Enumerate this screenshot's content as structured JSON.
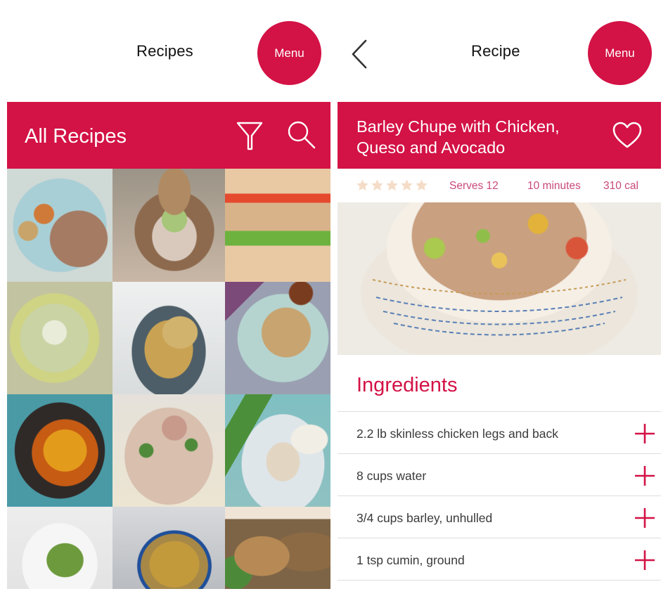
{
  "colors": {
    "brand": "#d31245",
    "meta_text": "#c9497a",
    "star": "#f4dcc7"
  },
  "list_screen": {
    "topbar_title": "Recipes",
    "menu_label": "Menu",
    "heading": "All Recipes",
    "icons": {
      "filter": "filter-icon",
      "search": "search-icon"
    },
    "recipes": [
      {
        "image": "meatloaf with roasted potatoes"
      },
      {
        "image": "chicken sandwich in hand"
      },
      {
        "image": "grilled chicken sub"
      },
      {
        "image": "chicken dumpling soup"
      },
      {
        "image": "chicken with chickpeas"
      },
      {
        "image": "chicken tenders with dip"
      },
      {
        "image": "orange chicken with chopsticks"
      },
      {
        "image": "chicken noodle salad"
      },
      {
        "image": "stuffed chicken breast with green beans"
      },
      {
        "image": "arugula salad"
      },
      {
        "image": "dumpling soup in bowl"
      },
      {
        "image": "roasted drumsticks with rice"
      }
    ]
  },
  "detail_screen": {
    "topbar_title": "Recipe",
    "menu_label": "Menu",
    "back_icon": "chevron-left-icon",
    "recipe_title_line1": "Barley Chupe with Chicken,",
    "recipe_title_line2": "Queso and Avocado",
    "favorite_icon": "heart-icon",
    "rating": {
      "value": 0,
      "max": 5
    },
    "serves": "Serves 12",
    "time": "10 minutes",
    "calories": "310 cal",
    "hero_image": "barley chupe soup in bowl",
    "ingredients_heading": "Ingredients",
    "ingredients": [
      {
        "text": "2.2 lb skinless chicken legs and back"
      },
      {
        "text": "8 cups water"
      },
      {
        "text": "3/4 cups barley, unhulled"
      },
      {
        "text": "1 tsp cumin, ground"
      }
    ]
  }
}
